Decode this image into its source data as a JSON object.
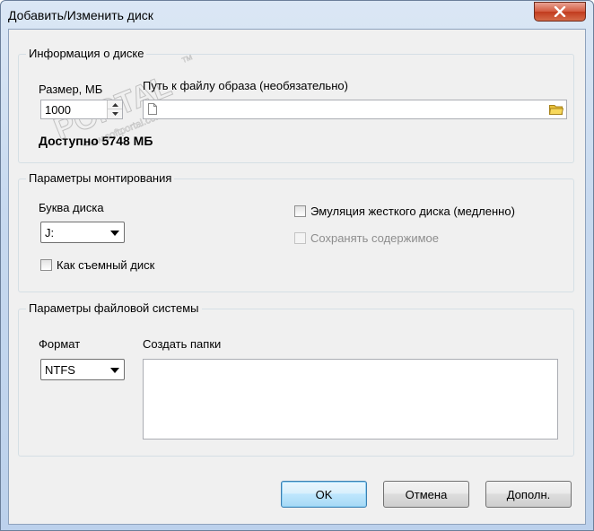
{
  "window": {
    "title": "Добавить/Изменить диск"
  },
  "disk_info": {
    "caption": "Информация о диске",
    "size_label": "Размер, МБ",
    "size_value": "1000",
    "path_label": "Путь к файлу образа (необязательно)",
    "path_value": "",
    "available_text": "Доступно 5748 МБ"
  },
  "mount": {
    "caption": "Параметры монтирования",
    "drive_letter_label": "Буква диска",
    "drive_letter_value": "J:",
    "removable_label": "Как съемный диск",
    "removable_checked": false,
    "hdd_emulation_label": "Эмуляция жесткого диска (медленно)",
    "hdd_emulation_checked": false,
    "persist_label": "Сохранять содержимое",
    "persist_checked": false
  },
  "filesystem": {
    "caption": "Параметры файловой системы",
    "format_label": "Формат",
    "format_value": "NTFS",
    "folders_label": "Создать папки",
    "folders_value": ""
  },
  "buttons": {
    "ok": "OK",
    "cancel": "Отмена",
    "more": "Дополн."
  },
  "watermark": {
    "brand": "PORTAL",
    "site": "www.softportal.com",
    "tm": "TM"
  },
  "colors": {
    "titlebar": "#c7d9ef",
    "close_button": "#c23b1e",
    "dialog_bg": "#f0f0f0",
    "default_button_border": "#3c7fb1"
  }
}
